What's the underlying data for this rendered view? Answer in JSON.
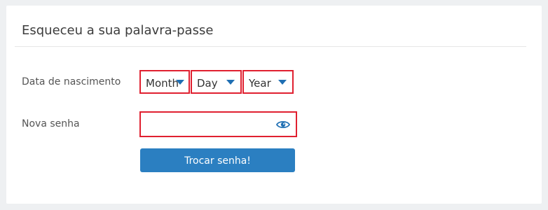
{
  "form": {
    "title": "Esqueceu a sua palavra-passe",
    "birthdate_label": "Data de nascimento",
    "month": {
      "value": "Month"
    },
    "day": {
      "value": "Day"
    },
    "year": {
      "value": "Year"
    },
    "new_password_label": "Nova senha",
    "new_password_value": "",
    "submit_label": "Trocar senha!"
  },
  "colors": {
    "accent": "#2b7fc1",
    "error_border": "#e02030",
    "icon": "#1f6fb3"
  },
  "icons": {
    "select_caret": "chevron-down-icon",
    "password_toggle": "eye-icon"
  }
}
